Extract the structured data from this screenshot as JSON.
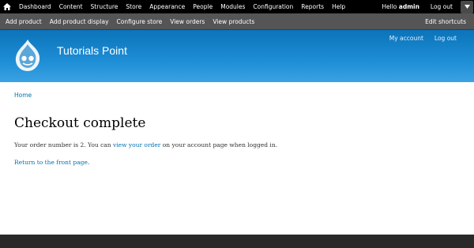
{
  "toolbar": {
    "home_icon": "home-icon",
    "menu": [
      "Dashboard",
      "Content",
      "Structure",
      "Store",
      "Appearance",
      "People",
      "Modules",
      "Configuration",
      "Reports",
      "Help"
    ],
    "hello_prefix": "Hello",
    "username": "admin",
    "logout": "Log out"
  },
  "shortcuts": {
    "items": [
      "Add product",
      "Add product display",
      "Configure store",
      "View orders",
      "View products"
    ],
    "edit": "Edit shortcuts"
  },
  "header": {
    "site_name": "Tutorials Point",
    "my_account": "My account",
    "logout": "Log out"
  },
  "breadcrumb": {
    "home": "Home"
  },
  "main": {
    "title": "Checkout complete",
    "message_before": "Your order number is 2. You can",
    "message_link": "view your order",
    "message_after": "on your account page when logged in.",
    "front_link": "Return to the front page",
    "front_after": "."
  },
  "colors": {
    "toolbar_bg": "#000000",
    "shortcuts_bg": "#555555",
    "header_top": "#0b73b9",
    "header_bottom": "#3ba2e3",
    "link": "#0071b3",
    "footer_bg": "#292929"
  }
}
